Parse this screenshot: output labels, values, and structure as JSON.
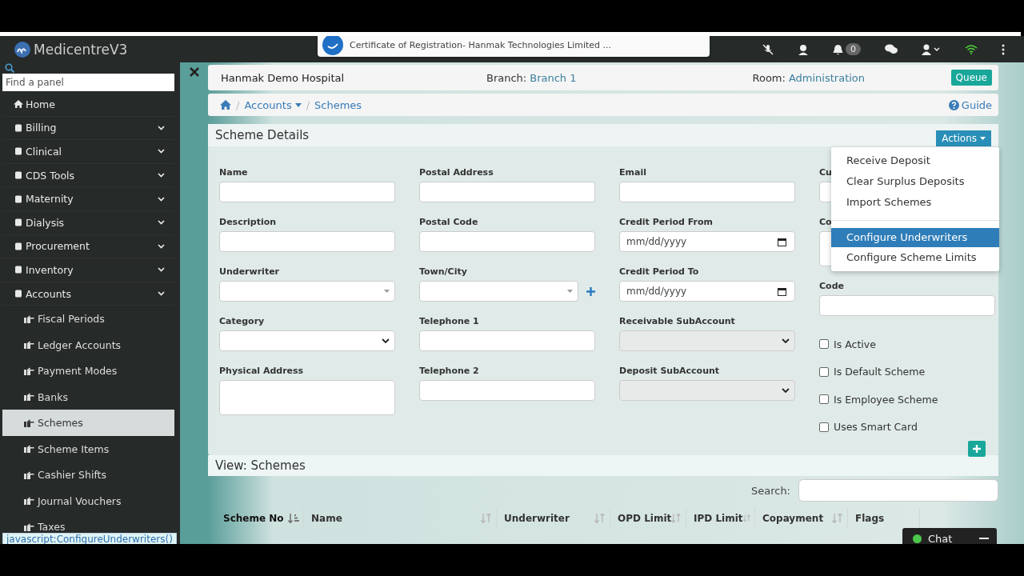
{
  "app": {
    "title": "MedicentreV3"
  },
  "toast": {
    "text": "Certificate of Registration- Hanmak Technologies Limited ..."
  },
  "navbar": {
    "notification_count": "0"
  },
  "sidebar": {
    "search_placeholder": "Find a panel",
    "items": [
      {
        "label": "Home",
        "has_caret": false,
        "selected": false
      },
      {
        "label": "Billing",
        "has_caret": true,
        "selected": false
      },
      {
        "label": "Clinical",
        "has_caret": true,
        "selected": false
      },
      {
        "label": "CDS Tools",
        "has_caret": true,
        "selected": false
      },
      {
        "label": "Maternity",
        "has_caret": true,
        "selected": false
      },
      {
        "label": "Dialysis",
        "has_caret": true,
        "selected": false
      },
      {
        "label": "Procurement",
        "has_caret": true,
        "selected": false
      },
      {
        "label": "Inventory",
        "has_caret": true,
        "selected": false
      },
      {
        "label": "Accounts",
        "has_caret": true,
        "selected": false,
        "children": [
          {
            "label": "Fiscal Periods",
            "selected": false
          },
          {
            "label": "Ledger Accounts",
            "selected": false
          },
          {
            "label": "Payment Modes",
            "selected": false
          },
          {
            "label": "Banks",
            "selected": false
          },
          {
            "label": "Schemes",
            "selected": true
          },
          {
            "label": "Scheme Items",
            "selected": false
          },
          {
            "label": "Cashier Shifts",
            "selected": false
          },
          {
            "label": "Journal Vouchers",
            "selected": false
          },
          {
            "label": "Taxes",
            "selected": false
          }
        ]
      }
    ]
  },
  "header": {
    "hospital": "Hanmak Demo Hospital",
    "branch_label": "Branch:",
    "branch": "Branch 1",
    "room_label": "Room:",
    "room": "Administration",
    "queue_button": "Queue"
  },
  "breadcrumb": {
    "separator": "/",
    "items": [
      "Accounts",
      "Schemes"
    ],
    "guide": "Guide"
  },
  "scheme_details": {
    "title": "Scheme Details",
    "actions_button": "Actions",
    "actions_menu": [
      {
        "kind": "item",
        "label": "Receive Deposit",
        "selected": false
      },
      {
        "kind": "item",
        "label": "Clear Surplus Deposits",
        "selected": false
      },
      {
        "kind": "item",
        "label": "Import Schemes",
        "selected": false
      },
      {
        "kind": "divider"
      },
      {
        "kind": "item",
        "label": "Configure Underwriters",
        "selected": true
      },
      {
        "kind": "item",
        "label": "Configure Scheme Limits",
        "selected": false
      }
    ],
    "columns": [
      [
        {
          "kind": "text",
          "label": "Name"
        },
        {
          "kind": "text",
          "label": "Description"
        },
        {
          "kind": "select",
          "label": "Underwriter",
          "disabled": false
        },
        {
          "kind": "native-select",
          "label": "Category",
          "disabled": false
        },
        {
          "kind": "textarea",
          "label": "Physical Address"
        }
      ],
      [
        {
          "kind": "text",
          "label": "Postal Address"
        },
        {
          "kind": "text",
          "label": "Postal Code"
        },
        {
          "kind": "select-add",
          "label": "Town/City",
          "disabled": false
        },
        {
          "kind": "text",
          "label": "Telephone 1"
        },
        {
          "kind": "text",
          "label": "Telephone 2"
        }
      ],
      [
        {
          "kind": "text",
          "label": "Email"
        },
        {
          "kind": "date",
          "label": "Credit Period From",
          "placeholder": "mm/dd/yyyy"
        },
        {
          "kind": "date",
          "label": "Credit Period To",
          "placeholder": "mm/dd/yyyy"
        },
        {
          "kind": "native-select",
          "label": "Receivable SubAccount",
          "disabled": true
        },
        {
          "kind": "native-select",
          "label": "Deposit SubAccount",
          "disabled": true
        }
      ],
      [
        {
          "kind": "text",
          "label": "Cu"
        },
        {
          "kind": "textarea",
          "label": "Co"
        },
        {
          "kind": "text",
          "label": "Code"
        },
        {
          "kind": "checkbox",
          "label": "Is Active",
          "checked": false
        },
        {
          "kind": "checkbox",
          "label": "Is Default Scheme",
          "checked": false
        },
        {
          "kind": "checkbox",
          "label": "Is Employee Scheme",
          "checked": false
        },
        {
          "kind": "checkbox",
          "label": "Uses Smart Card",
          "checked": false
        }
      ]
    ]
  },
  "view_schemes": {
    "title": "View: Schemes",
    "search_label": "Search:",
    "columns": [
      {
        "label": "Scheme No",
        "sorted": true
      },
      {
        "label": "Name",
        "sorted": false
      },
      {
        "label": "Underwriter",
        "sorted": false
      },
      {
        "label": "OPD Limit",
        "sorted": false
      },
      {
        "label": "IPD Limit",
        "sorted": false
      },
      {
        "label": "Copayment",
        "sorted": false
      },
      {
        "label": "Flags",
        "sorted": false
      }
    ]
  },
  "chat": {
    "label": "Chat"
  },
  "status_bar": {
    "text": "javascript:ConfigureUnderwriters()"
  }
}
